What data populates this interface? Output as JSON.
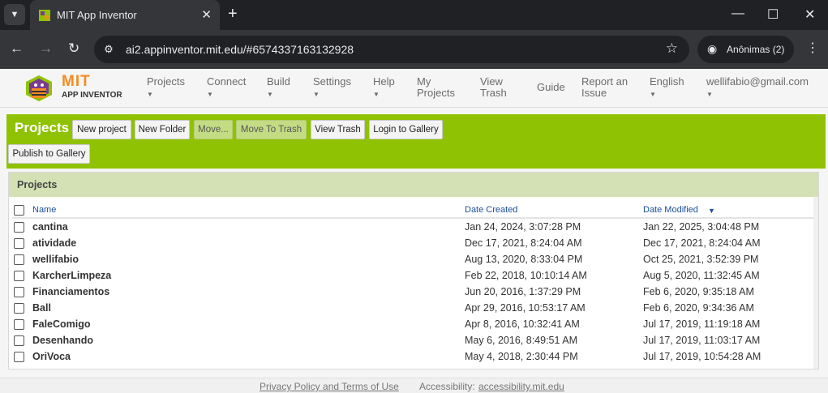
{
  "browser": {
    "tab_title": "MIT App Inventor",
    "url": "ai2.appinventor.mit.edu/#6574337163132928",
    "incognito_label": "Anônimas (2)"
  },
  "header": {
    "logo_mit": "MIT",
    "logo_sub": "APP INVENTOR",
    "menus": {
      "projects": "Projects",
      "connect": "Connect",
      "build": "Build",
      "settings": "Settings",
      "help": "Help",
      "my_projects_1": "My",
      "my_projects_2": "Projects",
      "view_trash_1": "View",
      "view_trash_2": "Trash",
      "guide": "Guide",
      "report_1": "Report an",
      "report_2": "Issue",
      "language": "English",
      "account": "wellifabio@gmail.com"
    }
  },
  "toolbar": {
    "title": "Projects",
    "new_project": "New project",
    "new_folder": "New Folder",
    "move": "Move...",
    "move_to_trash": "Move To Trash",
    "view_trash": "View Trash",
    "login_gallery": "Login to Gallery",
    "publish_gallery": "Publish to Gallery"
  },
  "panel": {
    "title": "Projects",
    "col_name": "Name",
    "col_created": "Date Created",
    "col_modified": "Date Modified",
    "sort_indicator": "▼"
  },
  "projects": [
    {
      "name": "cantina",
      "created": "Jan 24, 2024, 3:07:28 PM",
      "modified": "Jan 22, 2025, 3:04:48 PM"
    },
    {
      "name": "atividade",
      "created": "Dec 17, 2021, 8:24:04 AM",
      "modified": "Dec 17, 2021, 8:24:04 AM"
    },
    {
      "name": "wellifabio",
      "created": "Aug 13, 2020, 8:33:04 PM",
      "modified": "Oct 25, 2021, 3:52:39 PM"
    },
    {
      "name": "KarcherLimpeza",
      "created": "Feb 22, 2018, 10:10:14 AM",
      "modified": "Aug 5, 2020, 11:32:45 AM"
    },
    {
      "name": "Financiamentos",
      "created": "Jun 20, 2016, 1:37:29 PM",
      "modified": "Feb 6, 2020, 9:35:18 AM"
    },
    {
      "name": "Ball",
      "created": "Apr 29, 2016, 10:53:17 AM",
      "modified": "Feb 6, 2020, 9:34:36 AM"
    },
    {
      "name": "FaleComigo",
      "created": "Apr 8, 2016, 10:32:41 AM",
      "modified": "Jul 17, 2019, 11:19:18 AM"
    },
    {
      "name": "Desenhando",
      "created": "May 6, 2016, 8:49:51 AM",
      "modified": "Jul 17, 2019, 11:03:17 AM"
    },
    {
      "name": "OriVoca",
      "created": "May 4, 2018, 2:30:44 PM",
      "modified": "Jul 17, 2019, 10:54:28 AM"
    }
  ],
  "footer": {
    "privacy": "Privacy Policy and Terms of Use",
    "accessibility_label": "Accessibility:",
    "accessibility_link": "accessibility.mit.edu"
  }
}
